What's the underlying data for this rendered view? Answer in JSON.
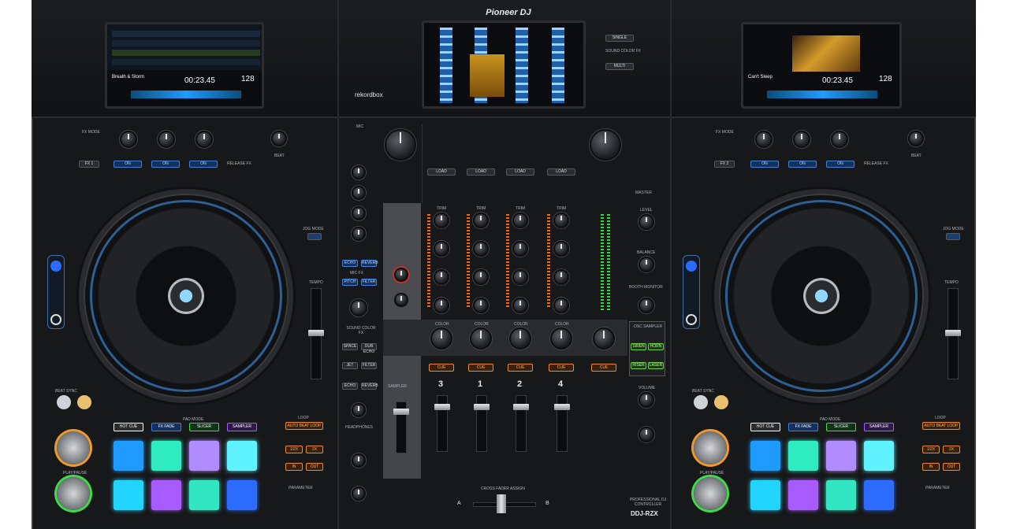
{
  "brand": "Pioneer DJ",
  "model": "DDJ-RZX",
  "rekordbox": "rekordbox",
  "left_deck": {
    "pad_mode_buttons": [
      "HOT CUE",
      "FX FADE",
      "SLICER",
      "SAMPLER"
    ],
    "pad_colors": [
      "#1f9bff",
      "#2eebc0",
      "#b08cff",
      "#5ff2ff",
      "#22d5ff",
      "#a85cff",
      "#33e6c2",
      "#2b6bff"
    ],
    "fx_buttons": [
      "ON",
      "ON",
      "ON"
    ],
    "loop_buttons": [
      "AUTO BEAT LOOP",
      "1/2X",
      "2X",
      "IN",
      "OUT"
    ],
    "screen_time": "00:23.45",
    "screen_bpm": "128",
    "label_fx_mode": "FX MODE",
    "label_fx": "FX 1",
    "label_release": "RELEASE FX",
    "label_beat": "BEAT",
    "label_jog_mode": "JOG MODE",
    "label_tempo": "TEMPO",
    "label_beat_sync": "BEAT SYNC",
    "label_play": "PLAY/PAUSE",
    "label_pad_mode": "PAD MODE",
    "label_loop": "LOOP",
    "label_parameter": "PARAMETER",
    "track_title": "Breath & Storm"
  },
  "right_deck": {
    "pad_mode_buttons": [
      "HOT CUE",
      "FX FADE",
      "SLICER",
      "SAMPLER"
    ],
    "pad_colors": [
      "#1f9bff",
      "#2eebc0",
      "#b08cff",
      "#5ff2ff",
      "#22d5ff",
      "#a85cff",
      "#33e6c2",
      "#2b6bff"
    ],
    "fx_buttons": [
      "ON",
      "ON",
      "ON"
    ],
    "loop_buttons": [
      "AUTO BEAT LOOP",
      "1/2X",
      "2X",
      "IN",
      "OUT"
    ],
    "screen_time": "00:23.45",
    "screen_bpm": "128",
    "label_fx_mode": "FX MODE",
    "label_fx": "FX 2",
    "label_release": "RELEASE FX",
    "label_beat": "BEAT",
    "label_jog_mode": "JOG MODE",
    "label_tempo": "TEMPO",
    "label_beat_sync": "BEAT SYNC",
    "label_play": "PLAY/PAUSE",
    "label_pad_mode": "PAD MODE",
    "label_loop": "LOOP",
    "label_parameter": "PARAMETER",
    "track_title": "Can't Sleep"
  },
  "mixer": {
    "channels": [
      "3",
      "1",
      "2",
      "4"
    ],
    "load_label": "LOAD",
    "cue_label": "CUE",
    "trim_label": "TRIM",
    "color_label": "COLOR",
    "mic_label": "MIC",
    "master_label": "MASTER",
    "level_label": "LEVEL",
    "balance_label": "BALANCE",
    "booth_label": "BOOTH MONITOR",
    "sampler_label": "SAMPLER",
    "osc_label": "OSC SAMPLER",
    "volume_label": "VOLUME",
    "headphones_label": "HEADPHONES",
    "sound_color_fx": "SOUND COLOR FX",
    "crossfader_label": "CROSS FADER ASSIGN",
    "xf_a": "A",
    "xf_b": "B",
    "sound_color_buttons": [
      "SPACE",
      "DUB ECHO",
      "JET",
      "FILTER"
    ],
    "osc_buttons": [
      "SIREN",
      "HORN",
      "RISER",
      "LASER"
    ],
    "mic_fx": "MIC FX",
    "mic_fx_buttons": [
      "ECHO",
      "REVERB",
      "PITCH",
      "FILTER"
    ],
    "fx_buttons": [
      "ECHO",
      "REVERB",
      "PITCH",
      "FILTER"
    ],
    "professional": "PROFESSIONAL DJ CONTROLLER"
  },
  "center_screen": {
    "menu_labels": [
      "SINGLE",
      "MULTI"
    ],
    "sound_color_fx": "SOUND COLOR FX"
  },
  "colors": {
    "accent_blue": "#3f7fd6",
    "accent_orange": "#f08a24",
    "jog_ring": "#46a0ff"
  }
}
